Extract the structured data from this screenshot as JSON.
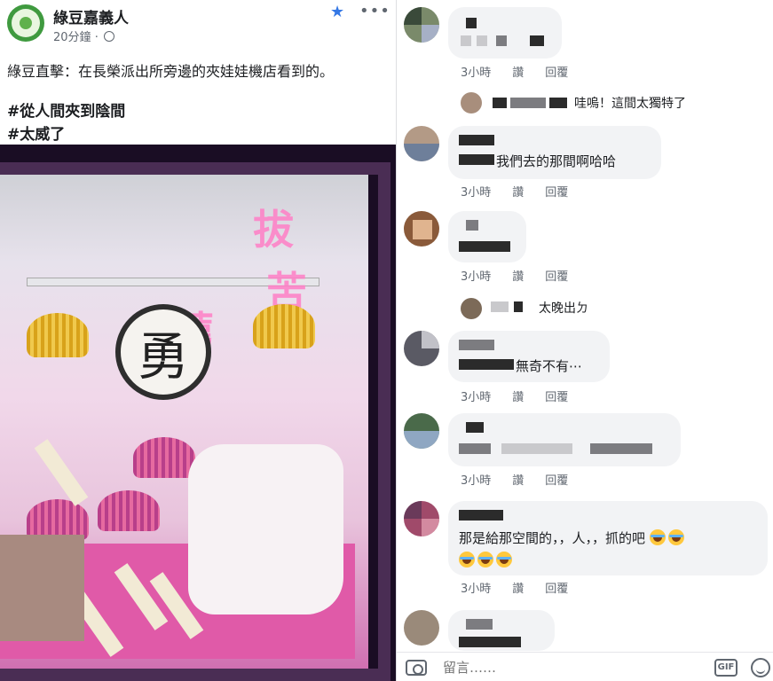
{
  "post": {
    "page_name": "綠豆嘉義人",
    "time": "20分鐘",
    "separator": "·",
    "body": "綠豆直擊：在長榮派出所旁邊的夾娃娃機店看到的。",
    "hashtags": [
      "#從人間夾到陰間",
      "#太威了"
    ],
    "avatar_icon": "page-logo",
    "star_icon": "star-icon",
    "more_icon": "more-options-icon",
    "photo_sign_char": "勇"
  },
  "comments": [
    {
      "text": "",
      "time": "3小時",
      "like": "讚",
      "reply": "回覆"
    },
    {
      "reply_text": "哇嗚！這間太獨特了"
    },
    {
      "text": "我們去的那間啊哈哈",
      "time": "3小時",
      "like": "讚",
      "reply": "回覆"
    },
    {
      "text": "",
      "time": "3小時",
      "like": "讚",
      "reply": "回覆"
    },
    {
      "reply_text": "太晚出ㄉ"
    },
    {
      "text": "無奇不有⋯",
      "time": "3小時",
      "like": "讚",
      "reply": "回覆"
    },
    {
      "text": "",
      "time": "3小時",
      "like": "讚",
      "reply": "回覆"
    },
    {
      "text": "那是給那空間的，，人，，抓的吧",
      "time": "3小時",
      "like": "讚",
      "reply": "回覆"
    }
  ],
  "composer": {
    "placeholder": "留言……",
    "gif_label": "GIF"
  },
  "colors": {
    "link_blue": "#3578e5",
    "bubble_gray": "#f2f3f5",
    "meta_gray": "#606770",
    "photo_pink": "#e05aa8"
  }
}
